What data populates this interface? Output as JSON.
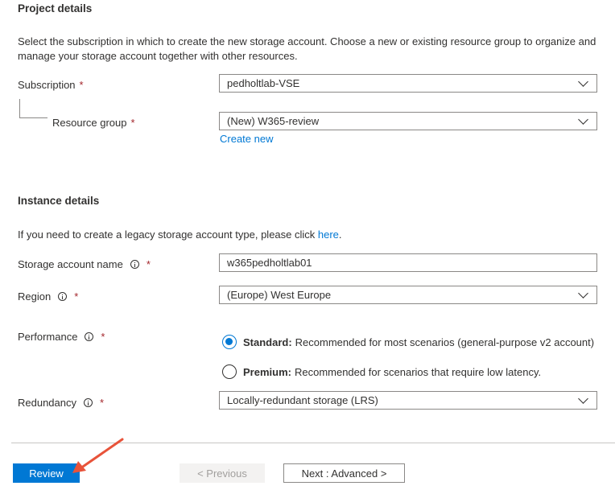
{
  "project": {
    "title": "Project details",
    "description": "Select the subscription in which to create the new storage account. Choose a new or existing resource group to organize and manage your storage account together with other resources.",
    "subscription_label": "Subscription",
    "subscription_value": "pedholtlab-VSE",
    "resource_group_label": "Resource group",
    "resource_group_value": "(New) W365-review",
    "create_new": "Create new",
    "required_mark": "*"
  },
  "instance": {
    "title": "Instance details",
    "legacy_text": "If you need to create a legacy storage account type, please click ",
    "legacy_link": "here",
    "legacy_end": ".",
    "name_label": "Storage account name",
    "name_value": "w365pedholtlab01",
    "region_label": "Region",
    "region_value": "(Europe) West Europe",
    "performance_label": "Performance",
    "standard_label": "Standard:",
    "standard_desc": "Recommended for most scenarios (general-purpose v2 account)",
    "premium_label": "Premium:",
    "premium_desc": "Recommended for scenarios that require low latency.",
    "redundancy_label": "Redundancy",
    "redundancy_value": "Locally-redundant storage (LRS)"
  },
  "footer": {
    "review": "Review",
    "previous": "< Previous",
    "next": "Next : Advanced >"
  },
  "colors": {
    "accent": "#0078d4",
    "required": "#a4262c",
    "annotation_arrow": "#e8533a"
  },
  "icons": {
    "info": "info-icon",
    "chevron": "chevron-down-icon",
    "arrow": "annotation-arrow-icon"
  }
}
